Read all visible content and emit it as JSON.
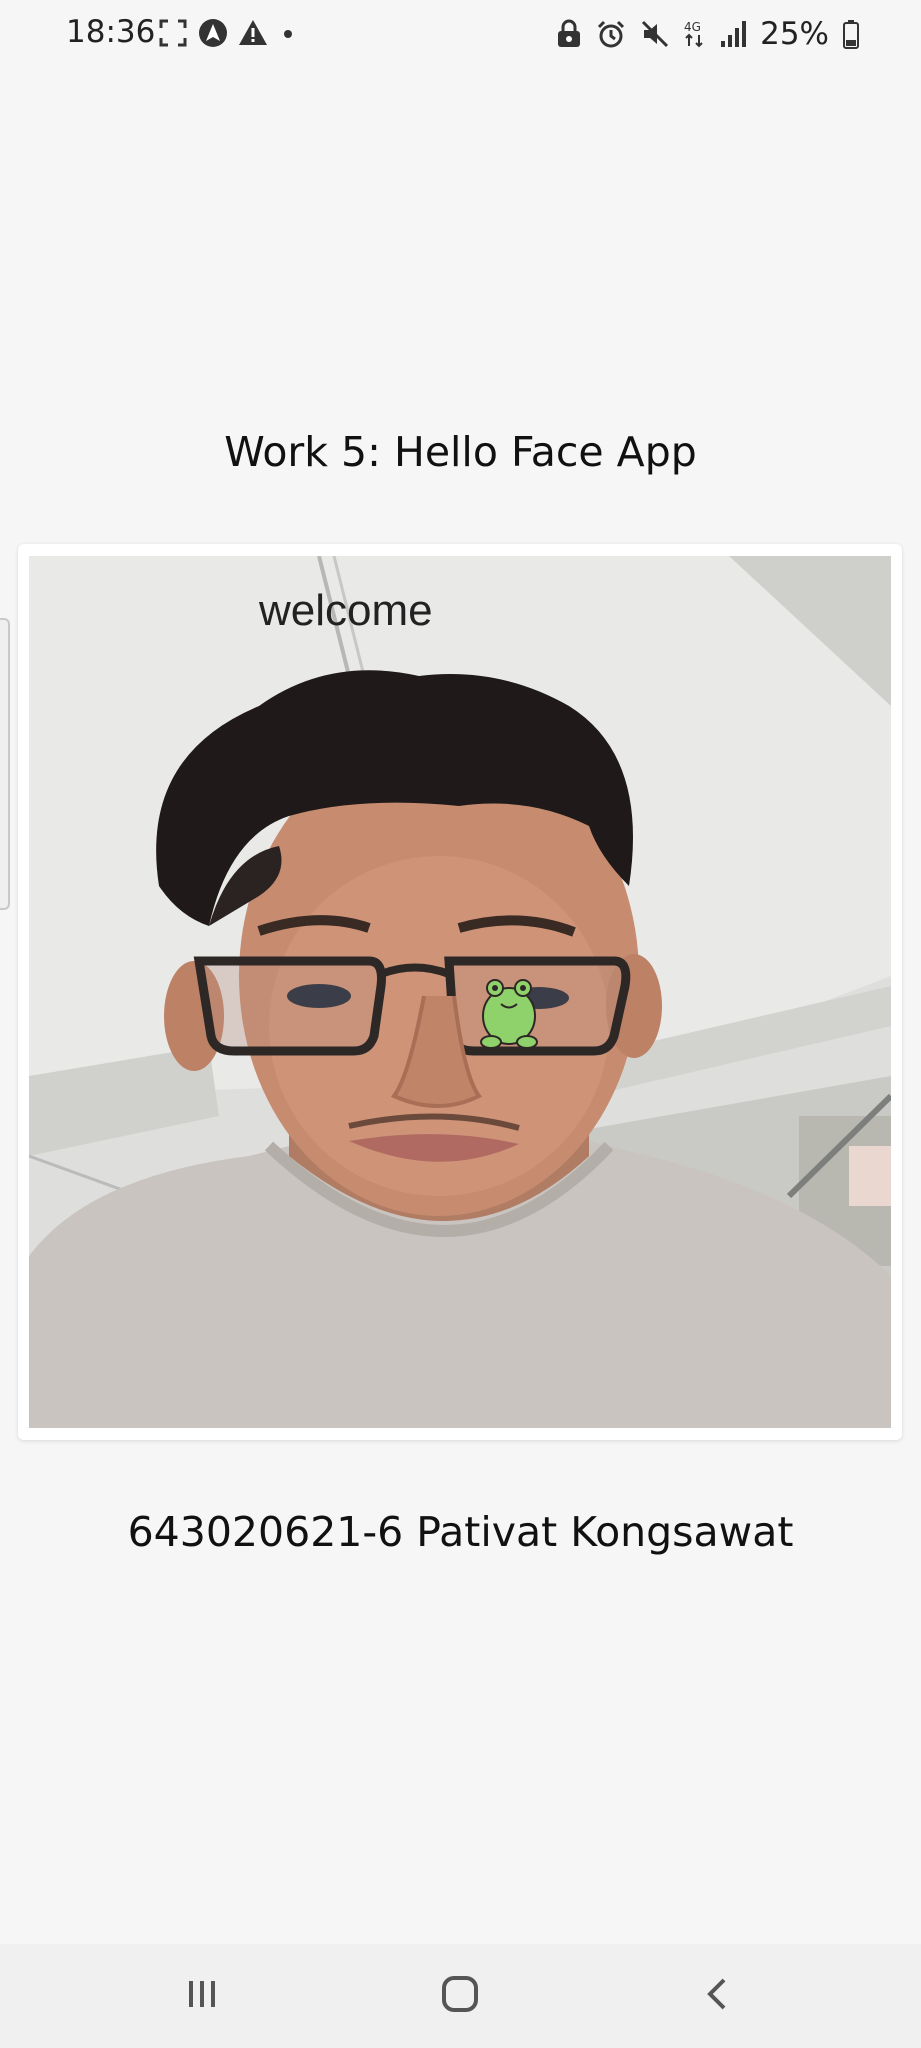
{
  "status_bar": {
    "time": "18:36",
    "battery_percent": "25%",
    "network": "4G",
    "icons": [
      "screenshot-frame-icon",
      "location-arrow-icon",
      "warning-icon",
      "dot-icon",
      "lock-app-icon",
      "alarm-icon",
      "mute-icon",
      "network-4g-icon",
      "signal-icon",
      "battery-icon"
    ]
  },
  "app": {
    "title": "Work 5: Hello Face App",
    "camera": {
      "overlay_text": "welcome",
      "sticker": "frog-sticker"
    },
    "student_label": "643020621-6 Pativat Kongsawat"
  },
  "nav_bar": {
    "buttons": [
      "recents-icon",
      "home-icon",
      "back-icon"
    ]
  },
  "colors": {
    "background": "#f6f6f6",
    "text": "#111111",
    "card": "#ffffff",
    "frog": "#8fd16a"
  }
}
